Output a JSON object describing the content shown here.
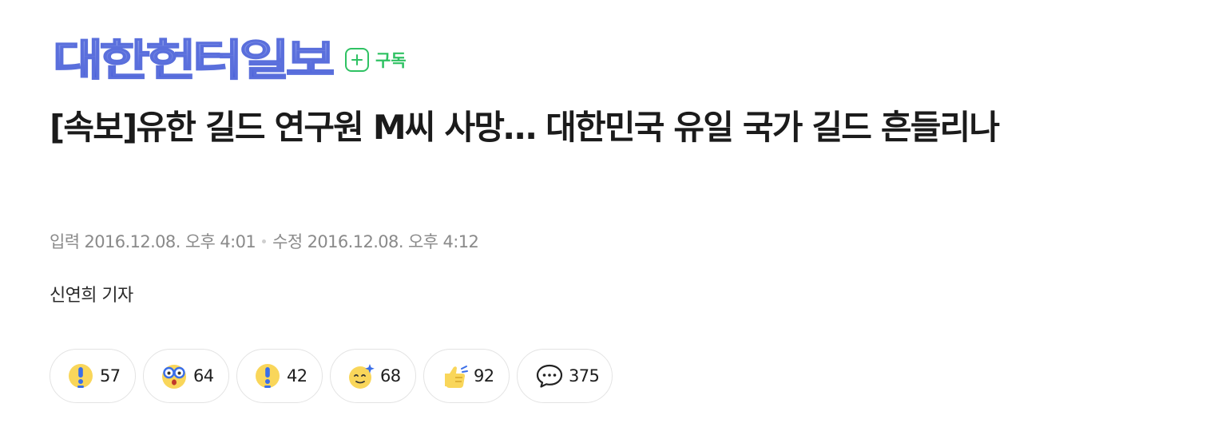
{
  "brand": {
    "logo_text": "대한헌터일보",
    "subscribe_label": "구독"
  },
  "article": {
    "title": "[속보]유한 길드 연구원 M씨 사망… 대한민국 유일 국가 길드 흔들리나",
    "published_label": "입력",
    "published": "2016.12.08. 오후 4:01",
    "modified_label": "수정",
    "modified": "2016.12.08. 오후 4:12",
    "byline": "신연희 기자"
  },
  "reactions": [
    {
      "icon": "exclamation-face-icon",
      "count": "57"
    },
    {
      "icon": "surprised-glasses-face-icon",
      "count": "64"
    },
    {
      "icon": "exclamation-face-icon",
      "count": "42"
    },
    {
      "icon": "sparkle-face-icon",
      "count": "68"
    },
    {
      "icon": "thumbs-up-icon",
      "count": "92"
    },
    {
      "icon": "comment-bubble-icon",
      "count": "375"
    }
  ],
  "colors": {
    "logo_gradient_start": "#7d8de6",
    "logo_gradient_end": "#3d55d8",
    "subscribe_green": "#2fc263",
    "emoji_yellow": "#f9d65a",
    "emoji_blue": "#3a6ee8"
  }
}
